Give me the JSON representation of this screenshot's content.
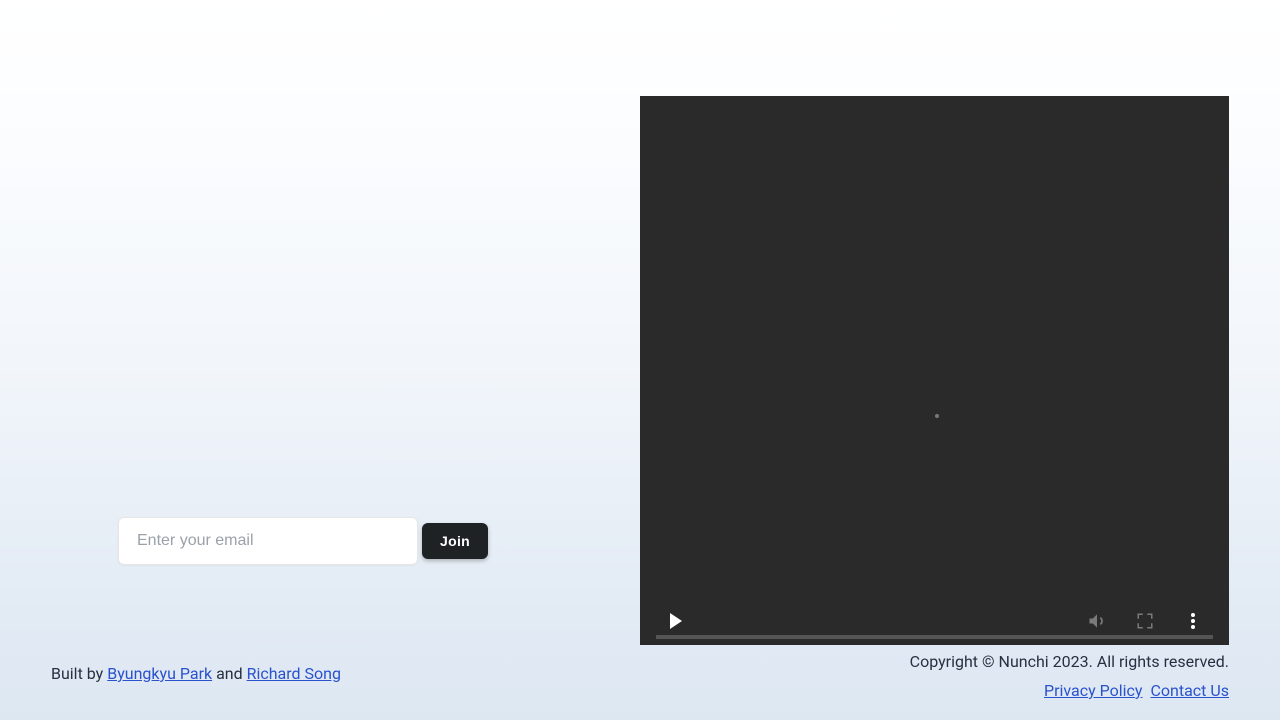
{
  "signup": {
    "email_placeholder": "Enter your email",
    "join_label": "Join"
  },
  "footer": {
    "built_by_prefix": "Built by ",
    "author1": "Byungkyu Park",
    "connector": " and ",
    "author2": "Richard Song",
    "copyright": "Copyright © Nunchi 2023. All rights reserved.",
    "privacy_label": "Privacy Policy",
    "contact_label": "Contact Us"
  }
}
